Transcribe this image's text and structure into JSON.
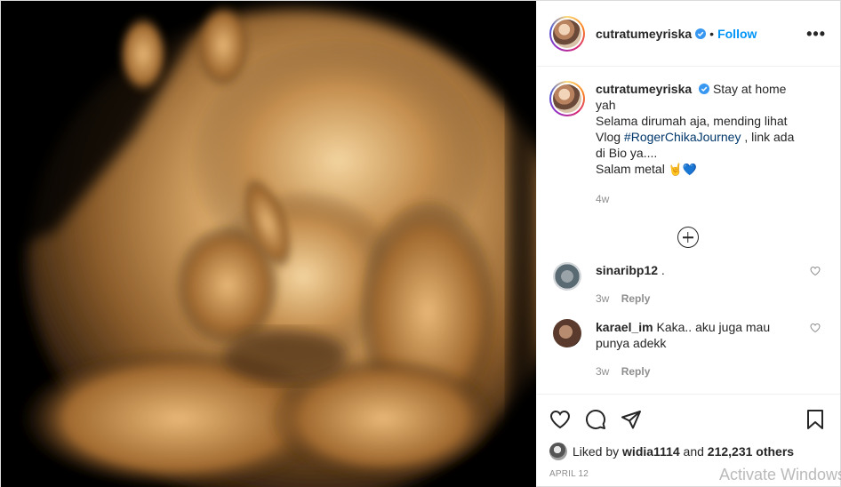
{
  "post": {
    "username": "cutratumeyriska",
    "follow_label": "Follow",
    "separator": "•",
    "more_label": "•••"
  },
  "caption": {
    "username": "cutratumeyriska",
    "text_1": "Stay at home yah",
    "text_2": "Selama dirumah aja, mending lihat Vlog",
    "hashtag": "#RogerChikaJourney",
    "text_3": ", link ada di Bio ya....",
    "text_4": "Salam metal",
    "emoji_hand": "🤘",
    "emoji_heart": "💙",
    "time": "4w"
  },
  "comments": [
    {
      "username": "sinaribp12",
      "text": ".",
      "time": "3w",
      "reply_label": "Reply"
    },
    {
      "username": "karael_im",
      "text": "Kaka.. aku juga mau punya adekk",
      "time": "3w",
      "reply_label": "Reply"
    }
  ],
  "likes": {
    "prefix": "Liked by",
    "user": "widia1114",
    "middle": "and",
    "count": "212,231 others"
  },
  "date": "APRIL 12",
  "watermark": "Activate Windows",
  "icons": {
    "verified": "verified-badge-icon",
    "like": "heart-icon",
    "comment": "comment-icon",
    "share": "paper-plane-icon",
    "save": "bookmark-icon",
    "load_more": "plus-circle-icon"
  },
  "colors": {
    "accent": "#0095f6",
    "hashtag": "#00376b",
    "verified": "#3897f0",
    "muted": "#8e8e8e"
  }
}
